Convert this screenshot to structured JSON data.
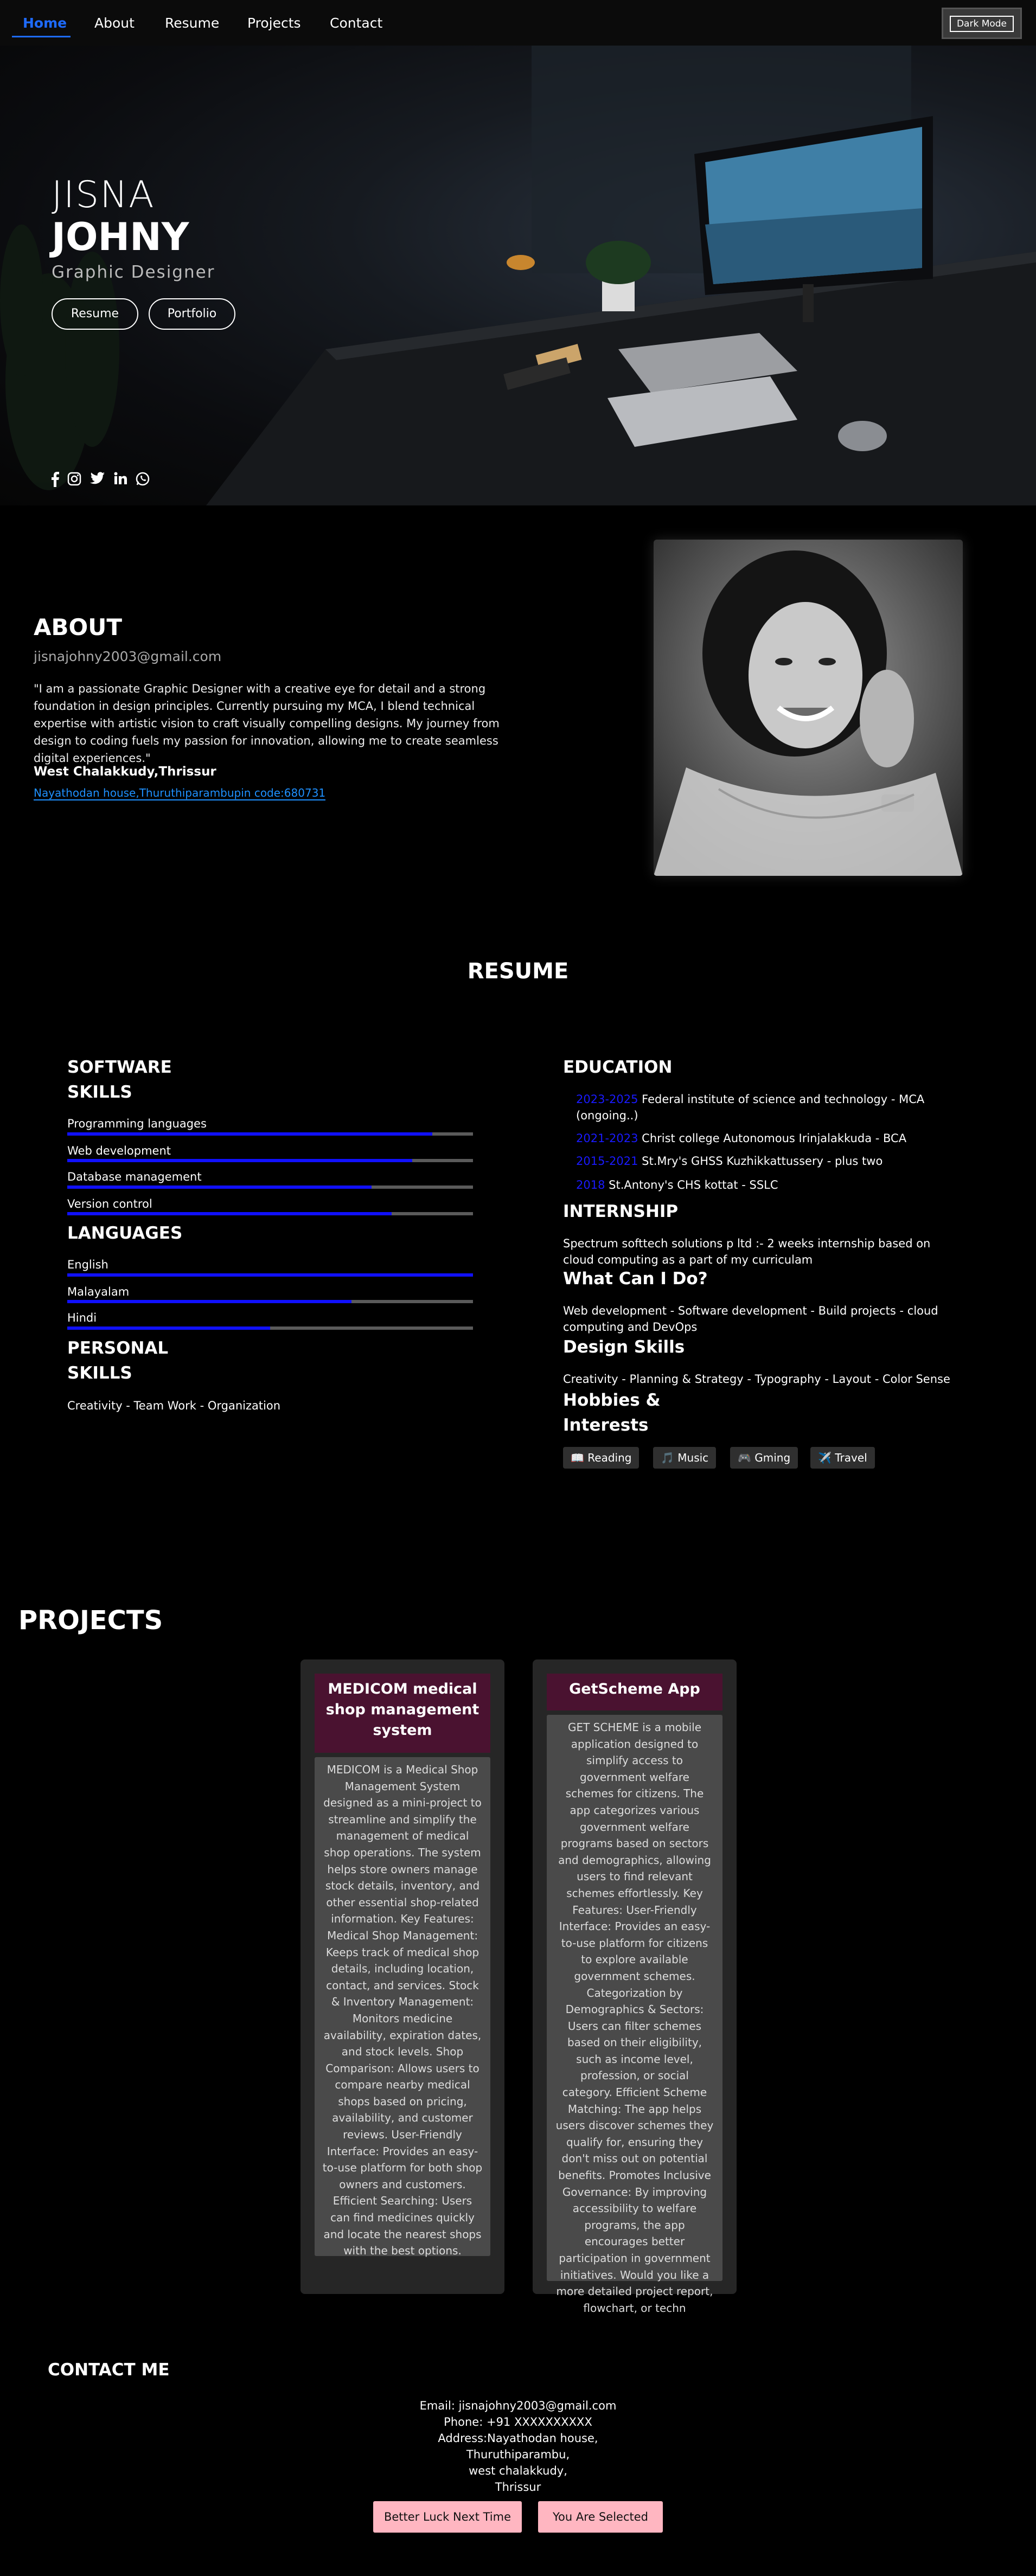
{
  "nav": {
    "items": [
      "Home",
      "About",
      "Resume",
      "Projects",
      "Contact"
    ],
    "dark_mode_label": "Dark Mode"
  },
  "hero": {
    "first_name": "JISNA",
    "last_name": "JOHNY",
    "role": "Graphic Designer",
    "buttons": [
      "Resume",
      "Portfolio"
    ],
    "social_icons": [
      "facebook-icon",
      "instagram-icon",
      "twitter-icon",
      "linkedin-icon",
      "whatsapp-icon"
    ]
  },
  "about": {
    "title": "ABOUT",
    "email": "jisnajohny2003@gmail.com",
    "text": "\"I am a passionate Graphic Designer with a creative eye for detail and a strong foundation in design principles. Currently pursuing my MCA, I blend technical expertise with artistic vision to craft visually compelling designs. My journey from design to coding fuels my passion for innovation, allowing me to create seamless digital experiences.\"",
    "city": "West Chalakkudy,Thrissur",
    "address": "Nayathodan house,Thuruthiparambupin code:680731"
  },
  "resume": {
    "title": "RESUME",
    "software_title_1": "SOFTWARE",
    "software_title_2": "SKILLS",
    "software_skills": [
      {
        "label": "Programming languages",
        "level": 0.9
      },
      {
        "label": "Web development",
        "level": 0.85
      },
      {
        "label": "Database management",
        "level": 0.75
      },
      {
        "label": "Version control",
        "level": 0.8
      }
    ],
    "languages_title": "LANGUAGES",
    "languages": [
      {
        "label": "English",
        "level": 1.0
      },
      {
        "label": "Malayalam",
        "level": 0.7
      },
      {
        "label": "Hindi",
        "level": 0.5
      }
    ],
    "personal_title_1": "PERSONAL",
    "personal_title_2": "SKILLS",
    "personal_skills": "Creativity - Team Work - Organization",
    "education_title": "EDUCATION",
    "education": [
      {
        "year": "2023-2025",
        "text": "Federal institute of science and technology - MCA",
        "extra": "(ongoing..)"
      },
      {
        "year": "2021-2023",
        "text": "Christ college Autonomous Irinjalakkuda - BCA",
        "extra": ""
      },
      {
        "year": "2015-2021",
        "text": "St.Mry's GHSS Kuzhikkattussery - plus two",
        "extra": ""
      },
      {
        "year": "2018",
        "text": "St.Antony's CHS kottat - SSLC",
        "extra": ""
      }
    ],
    "internship_title": "INTERNSHIP",
    "internship_text": "Spectrum softtech solutions p ltd :- 2 weeks internship based on cloud computing as a part of my curriculam",
    "what_title": "What Can I Do?",
    "what_text": "Web development - Software development - Build projects - cloud computing and DevOps",
    "design_title": "Design Skills",
    "design_text": "Creativity - Planning & Strategy - Typography - Layout - Color Sense",
    "hobbies_title_1": "Hobbies &",
    "hobbies_title_2": "Interests",
    "hobbies": [
      {
        "icon": "📖",
        "label": "Reading"
      },
      {
        "icon": "🎵",
        "label": "Music"
      },
      {
        "icon": "🎮",
        "label": "Gming"
      },
      {
        "icon": "✈️",
        "label": "Travel"
      }
    ]
  },
  "projects": {
    "title": "PROJECTS",
    "items": [
      {
        "title": "MEDICOM medical shop management system",
        "description": "MEDICOM is a Medical Shop Management System designed as a mini-project to streamline and simplify the management of medical shop operations. The system helps store owners manage stock details, inventory, and other essential shop-related information. Key Features: Medical Shop Management: Keeps track of medical shop details, including location, contact, and services. Stock & Inventory Management: Monitors medicine availability, expiration dates, and stock levels. Shop Comparison: Allows users to compare nearby medical shops based on pricing, availability, and customer reviews. User-Friendly Interface: Provides an easy-to-use platform for both shop owners and customers. Efficient Searching: Users can find medicines quickly and locate the nearest shops with the best options."
      },
      {
        "title": "GetScheme App",
        "description": "GET SCHEME is a mobile application designed to simplify access to government welfare schemes for citizens. The app categorizes various government welfare programs based on sectors and demographics, allowing users to find relevant schemes effortlessly. Key Features: User-Friendly Interface: Provides an easy-to-use platform for citizens to explore available government schemes. Categorization by Demographics & Sectors: Users can filter schemes based on their eligibility, such as income level, profession, or social category. Efficient Scheme Matching: The app helps users discover schemes they qualify for, ensuring they don't miss out on potential benefits. Promotes Inclusive Governance: By improving accessibility to welfare programs, the app encourages better participation in government initiatives. Would you like a more detailed project report, flowchart, or techn"
      }
    ]
  },
  "contact": {
    "title": "CONTACT ME",
    "email": "Email: jisnajohny2003@gmail.com",
    "phone": "Phone: +91 XXXXXXXXXX",
    "address_lines": [
      "Address:Nayathodan house,",
      "Thuruthiparambu,",
      "west chalakkudy,",
      "Thrissur"
    ],
    "buttons": [
      "Better Luck Next Time",
      "You Are Selected"
    ]
  },
  "colors": {
    "accent": "#1e6bff",
    "bar_fill": "#1010ff",
    "project_title_bg": "#4a1230",
    "contact_button": "#ffb6c1"
  }
}
